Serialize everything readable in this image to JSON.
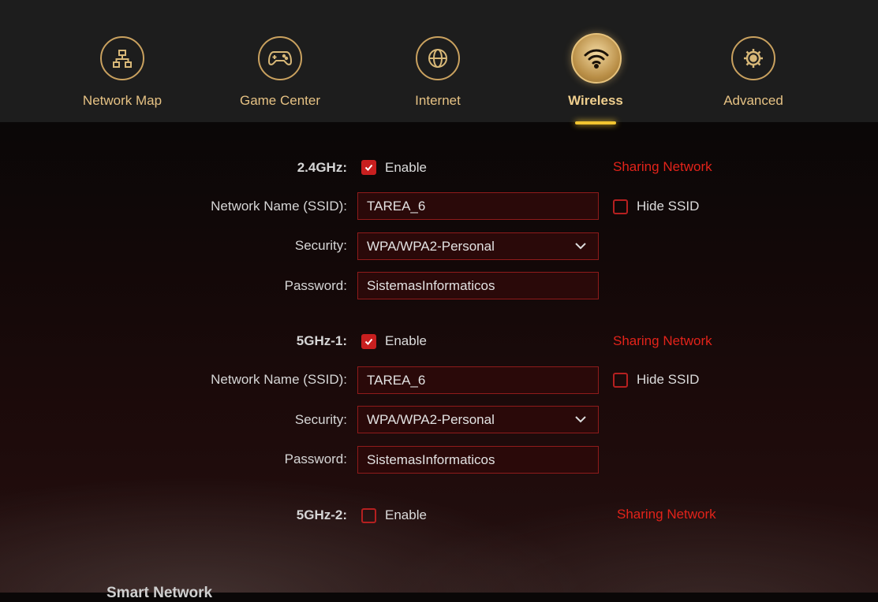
{
  "nav": {
    "items": [
      {
        "label": "Network Map",
        "icon": "network-map-icon"
      },
      {
        "label": "Game Center",
        "icon": "gamepad-icon"
      },
      {
        "label": "Internet",
        "icon": "globe-icon"
      },
      {
        "label": "Wireless",
        "icon": "wifi-icon",
        "active": true
      },
      {
        "label": "Advanced",
        "icon": "gear-icon"
      }
    ]
  },
  "bands": [
    {
      "name": "2.4GHz:",
      "enabled": true,
      "enable_label": "Enable",
      "sharing_label": "Sharing Network",
      "ssid_label": "Network Name (SSID):",
      "ssid": "TAREA_6",
      "hide_ssid_label": "Hide SSID",
      "hide_ssid": false,
      "security_label": "Security:",
      "security": "WPA/WPA2-Personal",
      "password_label": "Password:",
      "password": "SistemasInformaticos"
    },
    {
      "name": "5GHz-1:",
      "enabled": true,
      "enable_label": "Enable",
      "sharing_label": "Sharing Network",
      "ssid_label": "Network Name (SSID):",
      "ssid": "TAREA_6",
      "hide_ssid_label": "Hide SSID",
      "hide_ssid": false,
      "security_label": "Security:",
      "security": "WPA/WPA2-Personal",
      "password_label": "Password:",
      "password": "SistemasInformaticos"
    },
    {
      "name": "5GHz-2:",
      "enabled": false,
      "enable_label": "Enable",
      "sharing_label": "Sharing Network"
    }
  ],
  "bottom_section_title": "Smart Network",
  "colors": {
    "accent_gold": "#e6c284",
    "accent_red": "#e2231a",
    "checkbox_red": "#c81f1f"
  }
}
